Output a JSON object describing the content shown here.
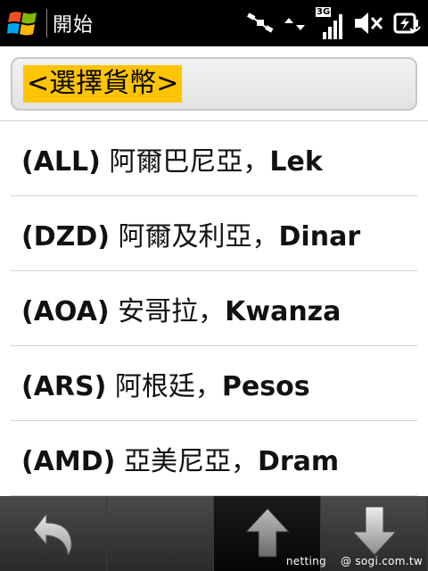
{
  "status_bar": {
    "title": "開始",
    "network_label": "3G",
    "icons": [
      "windows-start-icon",
      "satellite-icon",
      "network-activity-icon",
      "signal-strength-icon",
      "volume-muted-icon",
      "battery-charging-icon"
    ]
  },
  "selector": {
    "label": "<選擇貨幣>",
    "highlight_color": "#ffc400"
  },
  "currencies": [
    {
      "code": "(ALL)",
      "country": "阿爾巴尼亞，",
      "unit": "Lek"
    },
    {
      "code": "(DZD)",
      "country": "阿爾及利亞，",
      "unit": "Dinar"
    },
    {
      "code": "(AOA)",
      "country": "安哥拉，",
      "unit": "Kwanza"
    },
    {
      "code": "(ARS)",
      "country": "阿根廷，",
      "unit": "Pesos"
    },
    {
      "code": "(AMD)",
      "country": "亞美尼亞，",
      "unit": "Dram"
    }
  ],
  "toolbar": {
    "buttons": [
      "back-icon",
      "blank",
      "scroll-up-icon",
      "scroll-down-icon"
    ]
  },
  "watermark": {
    "left": "netting",
    "right": "@ sogi.com.tw"
  }
}
